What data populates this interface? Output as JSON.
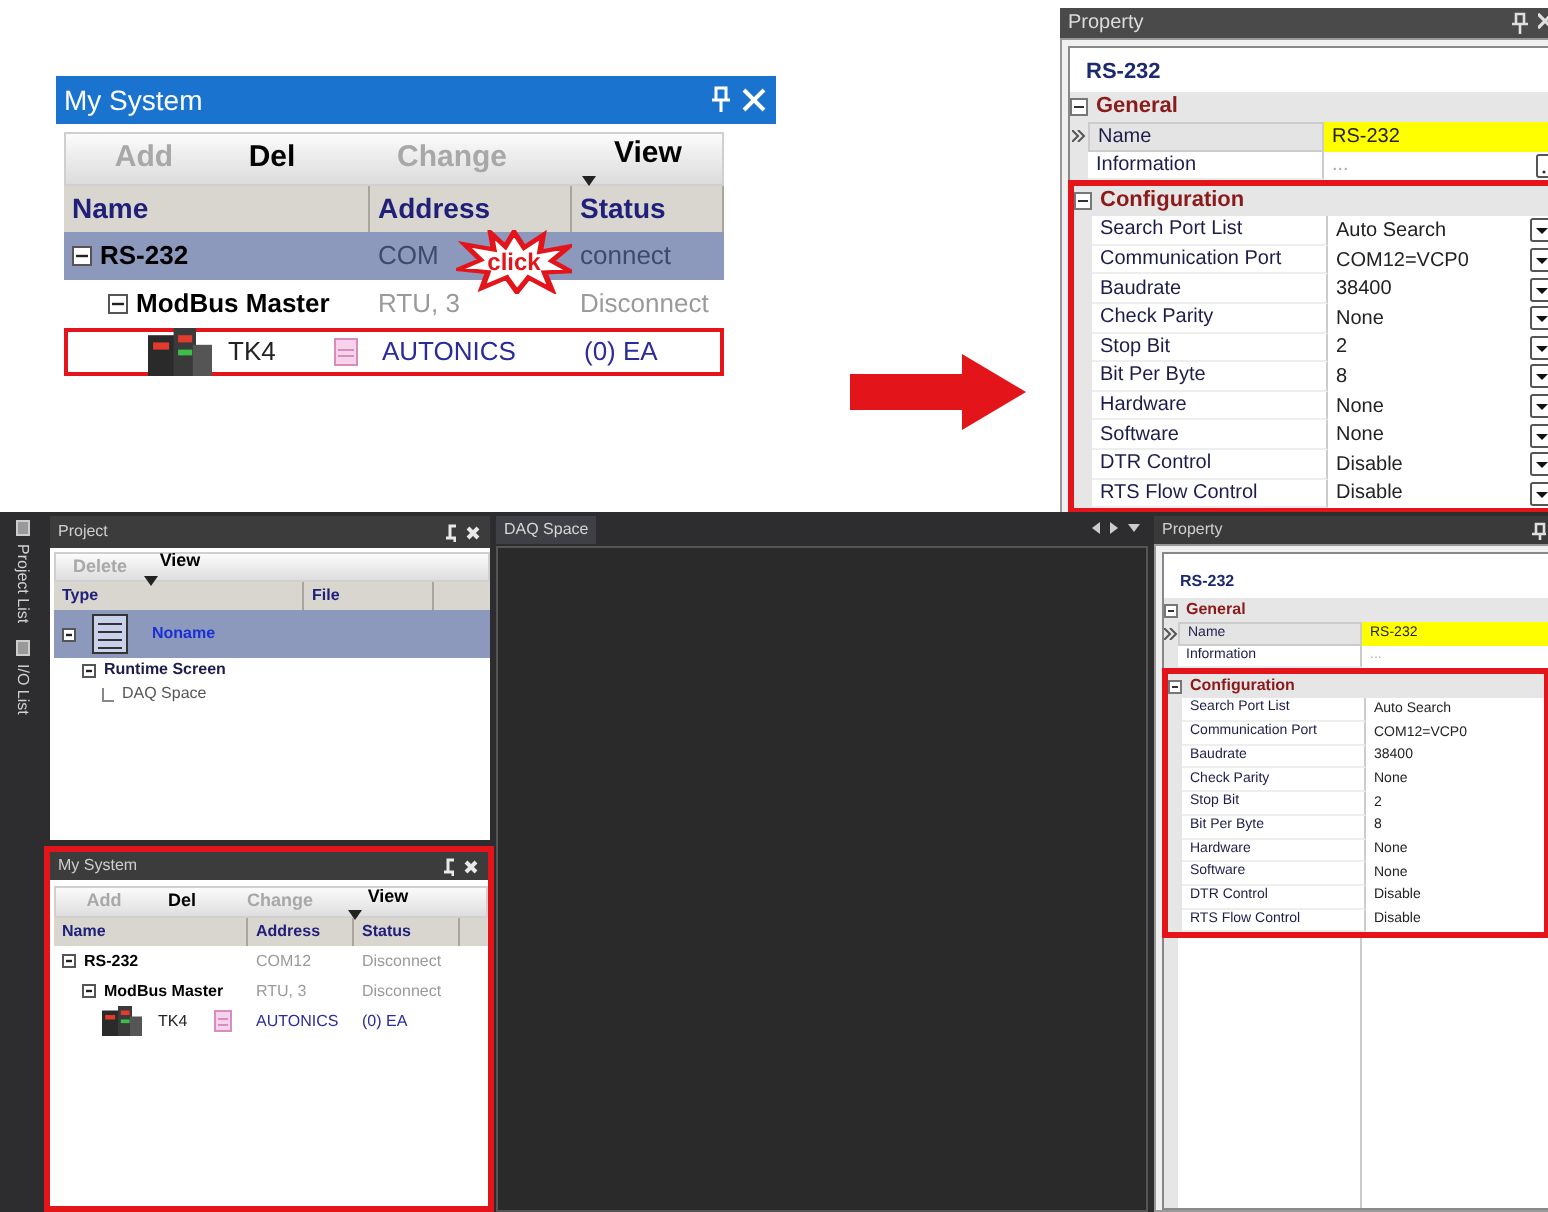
{
  "callout": {
    "title": "My System",
    "toolbar": [
      {
        "label": "Add",
        "disabled": true
      },
      {
        "label": "Del",
        "disabled": false
      },
      {
        "label": "Change",
        "disabled": true
      },
      {
        "label": "View",
        "disabled": false,
        "kind": "menu"
      }
    ],
    "columns": [
      "Name",
      "Address",
      "Status"
    ],
    "rows": [
      {
        "name": "RS-232",
        "address": "COM",
        "status": "connect",
        "selected": true,
        "highlighted": false,
        "kind": "port",
        "expanded": true,
        "children": [
          {
            "name": "ModBus Master",
            "address": "RTU, 3",
            "status": "Disconnect",
            "selected": false,
            "highlighted": false,
            "kind": "master",
            "expanded": true,
            "children": [
              {
                "name": "TK4",
                "address": "AUTONICS",
                "status": "(0) EA",
                "selected": false,
                "highlighted": true,
                "kind": "device"
              }
            ]
          }
        ]
      }
    ],
    "burst": {
      "label": "click"
    }
  },
  "top_property": {
    "title": "Property",
    "object": "RS-232",
    "groups": [
      {
        "label": "General",
        "expanded": true,
        "highlighted": false,
        "rows": [
          {
            "label": "Name",
            "value": "RS-232",
            "selected": true
          },
          {
            "label": "Information",
            "value": "...",
            "selected": false,
            "kind": "ellipsis"
          }
        ]
      },
      {
        "label": "Configuration",
        "expanded": true,
        "highlighted": true,
        "rows": [
          {
            "label": "Search Port List",
            "value": "Auto Search",
            "selected": false,
            "kind": "dropdown"
          },
          {
            "label": "Communication Port",
            "value": "COM12=VCP0",
            "selected": false,
            "kind": "dropdown"
          },
          {
            "label": "Baudrate",
            "value": "38400",
            "selected": false,
            "kind": "dropdown"
          },
          {
            "label": "Check Parity",
            "value": "None",
            "selected": false,
            "kind": "dropdown"
          },
          {
            "label": "Stop Bit",
            "value": "2",
            "selected": false,
            "kind": "dropdown"
          },
          {
            "label": "Bit Per Byte",
            "value": "8",
            "selected": false,
            "kind": "dropdown"
          },
          {
            "label": "Hardware",
            "value": "None",
            "selected": false,
            "kind": "dropdown"
          },
          {
            "label": "Software",
            "value": "None",
            "selected": false,
            "kind": "dropdown"
          },
          {
            "label": "DTR Control",
            "value": "Disable",
            "selected": false,
            "kind": "dropdown"
          },
          {
            "label": "RTS Flow Control",
            "value": "Disable",
            "selected": false,
            "kind": "dropdown"
          }
        ]
      }
    ]
  },
  "app": {
    "side_tabs": [
      {
        "label": "Project List"
      },
      {
        "label": "I/O List"
      }
    ],
    "project": {
      "title": "Project",
      "toolbar": [
        {
          "label": "Delete",
          "disabled": true
        },
        {
          "label": "View",
          "disabled": false,
          "kind": "menu"
        }
      ],
      "columns": [
        "Type",
        "File"
      ],
      "rows": [
        {
          "name": "Noname",
          "selected": true,
          "kind": "project",
          "expanded": true,
          "children": [
            {
              "name": "Runtime Screen",
              "selected": false,
              "kind": "folder",
              "expanded": true,
              "children": [
                {
                  "name": "DAQ Space",
                  "selected": false,
                  "kind": "screen"
                }
              ]
            }
          ]
        }
      ]
    },
    "my_system": {
      "title": "My System",
      "highlighted": true,
      "toolbar": [
        {
          "label": "Add",
          "disabled": true
        },
        {
          "label": "Del",
          "disabled": false
        },
        {
          "label": "Change",
          "disabled": true
        },
        {
          "label": "View",
          "disabled": false,
          "kind": "menu"
        }
      ],
      "columns": [
        "Name",
        "Address",
        "Status"
      ],
      "rows": [
        {
          "name": "RS-232",
          "address": "COM12",
          "status": "Disconnect",
          "selected": false,
          "highlighted": false,
          "kind": "port",
          "expanded": true,
          "children": [
            {
              "name": "ModBus Master",
              "address": "RTU, 3",
              "status": "Disconnect",
              "selected": false,
              "highlighted": false,
              "kind": "master",
              "expanded": true,
              "children": [
                {
                  "name": "TK4",
                  "address": "AUTONICS",
                  "status": "(0) EA",
                  "selected": false,
                  "highlighted": false,
                  "kind": "device"
                }
              ]
            }
          ]
        }
      ]
    },
    "document_tab": {
      "title": "DAQ Space"
    },
    "property": {
      "title": "Property",
      "object": "RS-232",
      "groups": [
        {
          "label": "General",
          "expanded": true,
          "highlighted": false,
          "rows": [
            {
              "label": "Name",
              "value": "RS-232",
              "selected": true
            },
            {
              "label": "Information",
              "value": "...",
              "selected": false
            }
          ]
        },
        {
          "label": "Configuration",
          "expanded": true,
          "highlighted": true,
          "rows": [
            {
              "label": "Search Port List",
              "value": "Auto Search",
              "selected": false
            },
            {
              "label": "Communication Port",
              "value": "COM12=VCP0",
              "selected": false
            },
            {
              "label": "Baudrate",
              "value": "38400",
              "selected": false
            },
            {
              "label": "Check Parity",
              "value": "None",
              "selected": false
            },
            {
              "label": "Stop Bit",
              "value": "2",
              "selected": false
            },
            {
              "label": "Bit Per Byte",
              "value": "8",
              "selected": false
            },
            {
              "label": "Hardware",
              "value": "None",
              "selected": false
            },
            {
              "label": "Software",
              "value": "None",
              "selected": false
            },
            {
              "label": "DTR Control",
              "value": "Disable",
              "selected": false
            },
            {
              "label": "RTS Flow Control",
              "value": "Disable",
              "selected": false
            }
          ]
        }
      ]
    }
  }
}
